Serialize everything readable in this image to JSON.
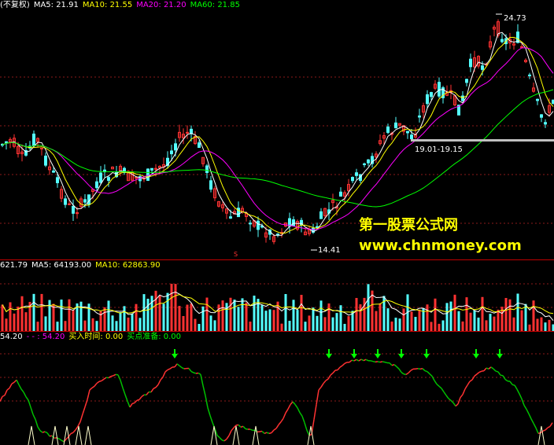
{
  "price_panel": {
    "legend": [
      {
        "text": "(不复权)",
        "color": "#ffffff",
        "name": "adjust-mode"
      },
      {
        "text": "MA5: 21.91",
        "color": "#ffffff",
        "name": "ma5"
      },
      {
        "text": "MA10: 21.55",
        "color": "#ffff00",
        "name": "ma10"
      },
      {
        "text": "MA20: 21.20",
        "color": "#ff00ff",
        "name": "ma20"
      },
      {
        "text": "MA60: 21.85",
        "color": "#00ff00",
        "name": "ma60"
      }
    ],
    "high_label": "24.73",
    "low_label": "14.41",
    "range_label": "19.01-19.15",
    "marker_s": "S"
  },
  "volume_panel": {
    "legend": [
      {
        "text": "621.79",
        "color": "#ffffff",
        "name": "vol"
      },
      {
        "text": "MA5: 64193.00",
        "color": "#ffffff",
        "name": "vma5"
      },
      {
        "text": "MA10: 62863.90",
        "color": "#ffff00",
        "name": "vma10"
      }
    ]
  },
  "indicator_panel": {
    "legend": [
      {
        "text": "54.20",
        "color": "#ffffff",
        "name": "ind-value"
      },
      {
        "text": "- - : 54.20",
        "color": "#ff00ff",
        "name": "ind-line"
      },
      {
        "text": "买入时间: 0.00",
        "color": "#ffff00",
        "name": "buy-time"
      },
      {
        "text": "买点准备: 0.00",
        "color": "#00ff00",
        "name": "buy-prep"
      }
    ]
  },
  "watermark": {
    "title": "第一股票公式网",
    "url": "www.chnmoney.com",
    "color": "#ffff00"
  },
  "colors": {
    "up": "#ff3232",
    "down": "#54ffff",
    "grid": "#8b1a1a",
    "separator": "#c00000",
    "range_bar": "#c0c0c0",
    "arrow": "#00ff00"
  }
}
